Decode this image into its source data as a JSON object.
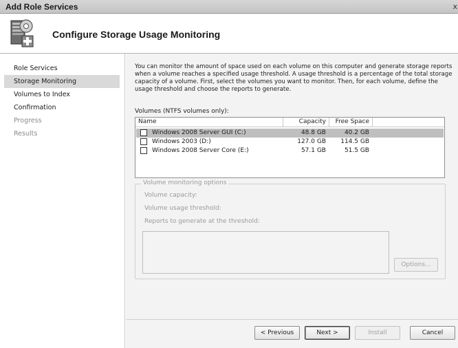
{
  "window": {
    "title": "Add Role Services",
    "close_glyph": "x"
  },
  "header": {
    "title": "Configure Storage Usage Monitoring",
    "icon": "storage-server-wizard-icon"
  },
  "sidebar": {
    "items": [
      {
        "label": "Role Services",
        "state": "normal"
      },
      {
        "label": "Storage Monitoring",
        "state": "active"
      },
      {
        "label": "Volumes to Index",
        "state": "normal"
      },
      {
        "label": "Confirmation",
        "state": "normal"
      },
      {
        "label": "Progress",
        "state": "disabled"
      },
      {
        "label": "Results",
        "state": "disabled"
      }
    ]
  },
  "main": {
    "intro": "You can monitor the amount of space used on each volume on this computer and generate storage reports when a volume reaches a specified usage threshold. A usage threshold is a percentage of the total storage capacity of a volume. First, select the volumes you want to monitor. Then, for each volume, define the usage threshold and choose the reports to generate.",
    "volumes_label": "Volumes (NTFS volumes only):",
    "columns": {
      "name": "Name",
      "capacity": "Capacity",
      "free": "Free Space"
    },
    "volumes": [
      {
        "name": "Windows 2008 Server GUI (C:)",
        "capacity": "48.8 GB",
        "free": "40.2 GB",
        "checked": false,
        "selected": true
      },
      {
        "name": "Windows 2003 (D:)",
        "capacity": "127.0 GB",
        "free": "114.5 GB",
        "checked": false,
        "selected": false
      },
      {
        "name": "Windows 2008 Server Core (E:)",
        "capacity": "57.1 GB",
        "free": "51.5 GB",
        "checked": false,
        "selected": false
      }
    ],
    "options_group": {
      "legend": "Volume monitoring options",
      "capacity_label": "Volume capacity:",
      "threshold_label": "Volume usage threshold:",
      "reports_label": "Reports to generate at the threshold:",
      "options_button": "Options..."
    }
  },
  "footer": {
    "previous": "< Previous",
    "next": "Next >",
    "install": "Install",
    "cancel": "Cancel"
  },
  "colors": {
    "selected_row": "#bfbfbf",
    "active_nav": "#d9d9d9",
    "panel_bg": "#f3f3f3"
  }
}
